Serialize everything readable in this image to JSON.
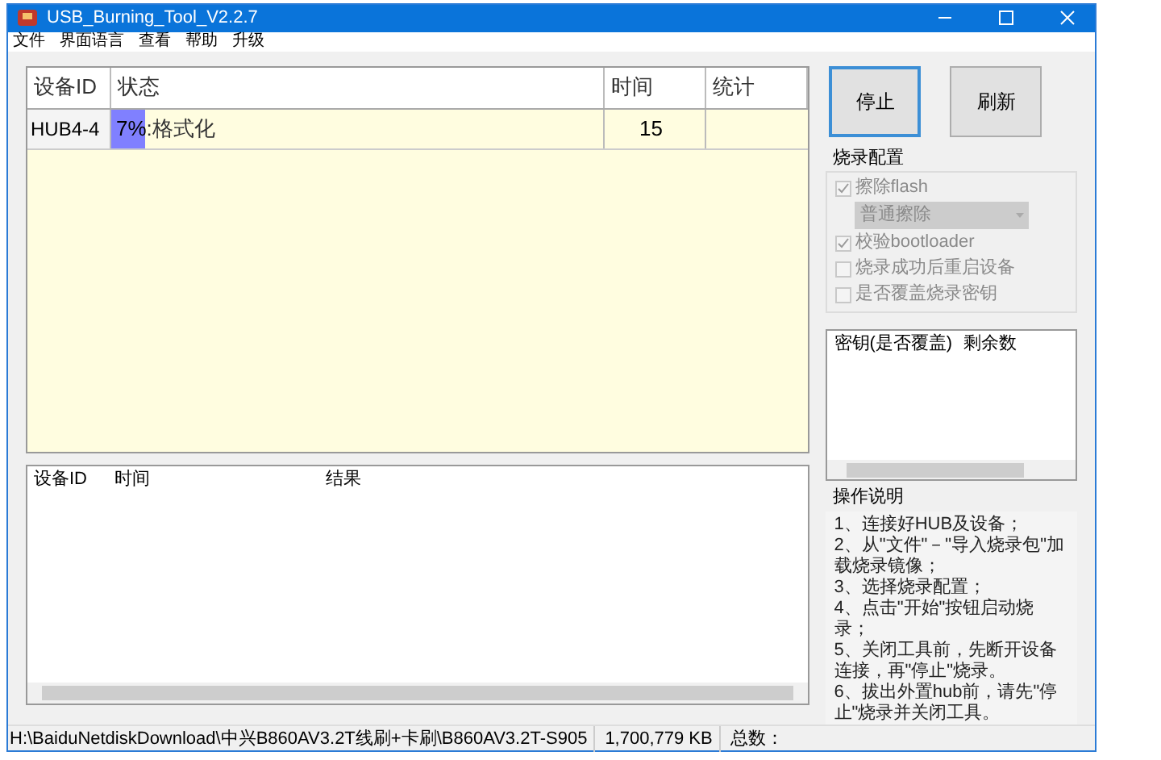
{
  "window": {
    "title": "USB_Burning_Tool_V2.2.7"
  },
  "menu": [
    "文件",
    "界面语言",
    "查看",
    "帮助",
    "升级"
  ],
  "device_table": {
    "columns": [
      "设备ID",
      "状态",
      "时间",
      "统计"
    ],
    "rows": [
      {
        "device_id": "HUB4-4",
        "progress": "7%",
        "level": 0.07,
        "status": ":格式化",
        "time": "15"
      }
    ]
  },
  "result_table": {
    "columns": [
      "设备ID",
      "时间",
      "结果"
    ]
  },
  "buttons": [
    {
      "label": "停止",
      "selected": true
    },
    {
      "label": "刷新",
      "selected": false
    }
  ],
  "burn_config": {
    "title": "烧录配置",
    "options": [
      {
        "kind": "checkbox",
        "label": "擦除flash",
        "checked": true,
        "disabled": true
      },
      {
        "kind": "dropdown",
        "value": "普通擦除",
        "disabled": true
      },
      {
        "kind": "checkbox",
        "label": "校验bootloader",
        "checked": true,
        "disabled": true
      },
      {
        "kind": "checkbox",
        "label": "烧录成功后重启设备",
        "checked": false,
        "disabled": true
      },
      {
        "kind": "checkbox",
        "label": "是否覆盖烧录密钥",
        "checked": false,
        "disabled": true
      }
    ]
  },
  "key_table": {
    "columns": [
      "密钥(是否覆盖)",
      "剩余数"
    ]
  },
  "instructions": {
    "title": "操作说明",
    "lines": [
      "1、连接好HUB及设备；",
      "2、从\"文件\"－\"导入烧录包\"加载烧录镜像；",
      "3、选择烧录配置；",
      "4、点击\"开始\"按钮启动烧录；",
      "5、关闭工具前，先断开设备连接，再\"停止\"烧录。",
      "6、拔出外置hub前，请先\"停止\"烧录并关闭工具。"
    ]
  },
  "status_bar": [
    "H:\\BaiduNetdiskDownload\\中兴B860AV3.2T线刷+卡刷\\B860AV3.2T-S905",
    "1,700,779 KB",
    "总数："
  ]
}
